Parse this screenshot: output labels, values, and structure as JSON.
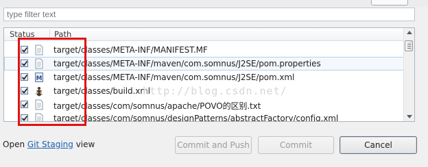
{
  "filter": {
    "placeholder": "type filter text"
  },
  "table": {
    "columns": [
      "Status",
      "Path"
    ],
    "rows": [
      {
        "path": "target/classes/META-INF/MANIFEST.MF",
        "icon": "text-file-icon",
        "checked": true
      },
      {
        "path": "target/classes/META-INF/maven/com.somnus/J2SE/pom.properties",
        "icon": "properties-file-icon",
        "checked": true
      },
      {
        "path": "target/classes/META-INF/maven/com.somnus/J2SE/pom.xml",
        "icon": "maven-pom-icon",
        "checked": true
      },
      {
        "path": "target/classes/build.xml",
        "icon": "ant-build-icon",
        "checked": true
      },
      {
        "path": "target/classes/com/somnus/apache/POVO的区别.txt",
        "icon": "text-file-icon",
        "checked": true
      },
      {
        "path": "target/classes/com/somnus/designPatterns/abstractFactory/config.xml",
        "icon": "text-file-icon",
        "checked": true
      }
    ]
  },
  "watermark": "http://blog.csdn.net/",
  "footer": {
    "prefix": "Open ",
    "link": "Git Staging",
    "suffix": " view"
  },
  "buttons": {
    "commit_and_push": "Commit and Push",
    "commit": "Commit",
    "cancel": "Cancel"
  },
  "colors": {
    "highlight": "#e01111",
    "link": "#1a5fb4",
    "selection_border": "#b7d1ec"
  }
}
